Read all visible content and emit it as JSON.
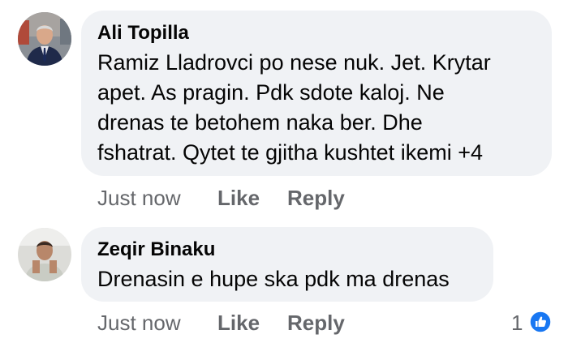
{
  "comments": [
    {
      "author": "Ali Topilla",
      "text_lines": [
        "Ramiz Lladrovci po nese nuk. Jet. Krytar",
        "apet. As pragin. Pdk sdote kaloj. Ne",
        "drenas  te betohem naka ber.   Dhe",
        "fshatrat. Qytet te gjitha kushtet ikemi  +4"
      ],
      "timestamp": "Just now",
      "like_label": "Like",
      "reply_label": "Reply"
    },
    {
      "author": "Zeqir Binaku",
      "text_lines": [
        "Drenasin e hupe ska pdk ma drenas"
      ],
      "timestamp": "Just now",
      "like_label": "Like",
      "reply_label": "Reply",
      "reaction_count": "1",
      "reaction_icon": "like-thumb-icon"
    }
  ],
  "colors": {
    "bubble": "#f0f2f5",
    "text": "#050505",
    "secondary": "#65676b",
    "like_blue": "#1877f2"
  }
}
